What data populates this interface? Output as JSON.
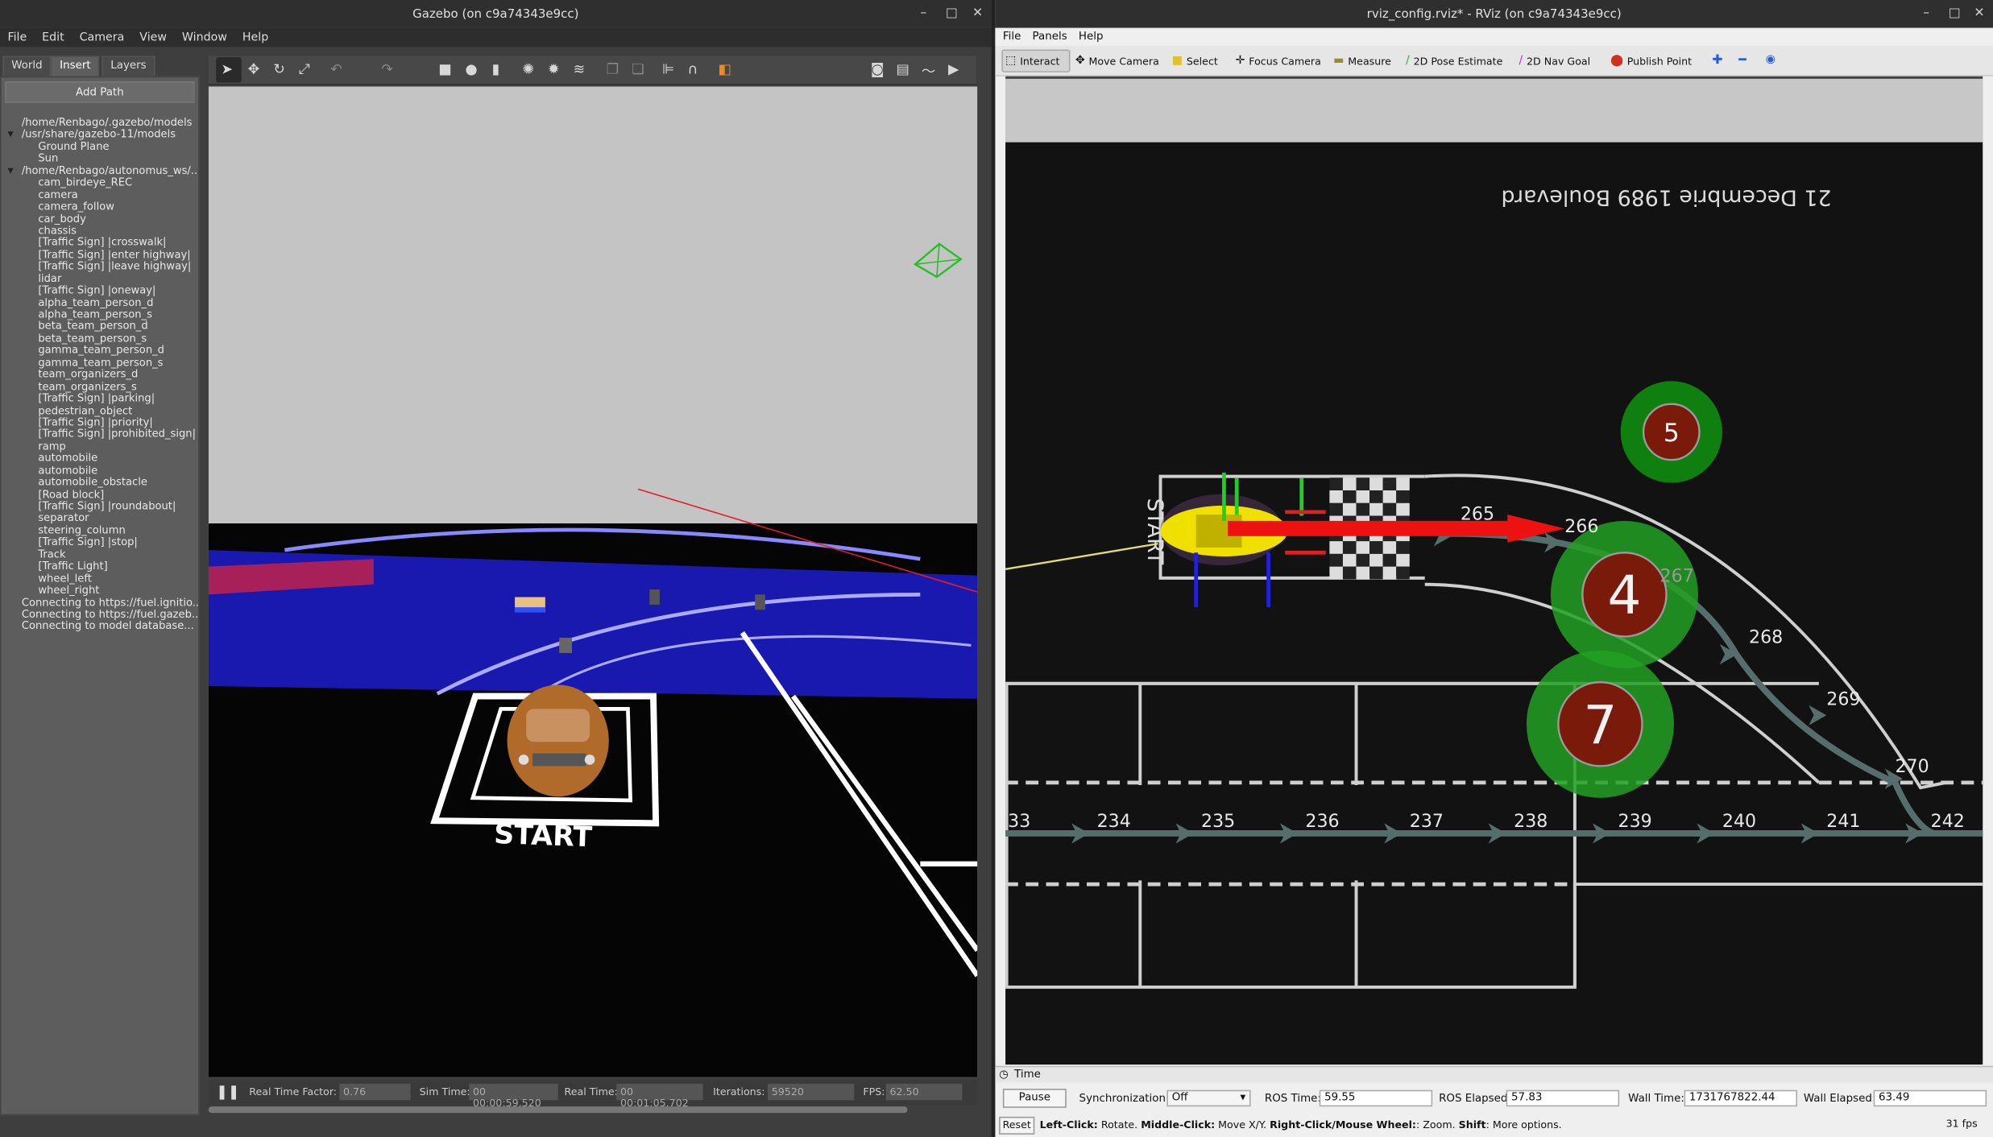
{
  "gazebo": {
    "title": "Gazebo (on c9a74343e9cc)",
    "menu": [
      "File",
      "Edit",
      "Camera",
      "View",
      "Window",
      "Help"
    ],
    "tabs": [
      "World",
      "Insert",
      "Layers"
    ],
    "add_path": "Add Path",
    "tree": [
      "/home/Renbago/.gazebo/models",
      "/usr/share/gazebo-11/models",
      "Ground Plane",
      "Sun",
      "/home/Renbago/autonomus_ws/...",
      "cam_birdeye_REC",
      "camera",
      "camera_follow",
      "car_body",
      "chassis",
      "[Traffic Sign] |crosswalk|",
      "[Traffic Sign] |enter highway|",
      "[Traffic Sign] |leave highway|",
      "lidar",
      "[Traffic Sign] |oneway|",
      "alpha_team_person_d",
      "alpha_team_person_s",
      "beta_team_person_d",
      "beta_team_person_s",
      "gamma_team_person_d",
      "gamma_team_person_s",
      "team_organizers_d",
      "team_organizers_s",
      "[Traffic Sign] |parking|",
      "pedestrian_object",
      "[Traffic Sign] |priority|",
      "[Traffic Sign] |prohibited_sign|",
      "ramp",
      "automobile",
      "automobile",
      "automobile_obstacle",
      "[Road block]",
      "[Traffic Sign] |roundabout|",
      "separator",
      "steering_column",
      "[Traffic Sign] |stop|",
      "Track",
      "[Traffic Light]",
      "wheel_left",
      "wheel_right",
      "Connecting to https://fuel.ignitio...",
      "Connecting to https://fuel.gazeb...",
      "Connecting to model database..."
    ],
    "status": {
      "rtf_label": "Real Time Factor:",
      "rtf": "0.76",
      "sim_label": "Sim Time:",
      "sim": "00 00:00:59.520",
      "real_label": "Real Time:",
      "real": "00 00:01:05.702",
      "iter_label": "Iterations:",
      "iter": "59520",
      "fps_label": "FPS:",
      "fps": "62.50"
    },
    "scene_text": "START"
  },
  "rviz": {
    "title": "rviz_config.rviz* - RViz (on c9a74343e9cc)",
    "menu": [
      "File",
      "Panels",
      "Help"
    ],
    "tools": [
      "Interact",
      "Move Camera",
      "Select",
      "Focus Camera",
      "Measure",
      "2D Pose Estimate",
      "2D Nav Goal",
      "Publish Point"
    ],
    "map_text": "21 Decembrie 1989 Boulevard",
    "start_text": "START",
    "circles": [
      "5",
      "4",
      "7"
    ],
    "nodes_top": [
      "265",
      "266",
      "267",
      "268",
      "269",
      "270"
    ],
    "nodes_bottom": [
      "33",
      "234",
      "235",
      "236",
      "237",
      "238",
      "239",
      "240",
      "241",
      "242"
    ],
    "time_panel": "Time",
    "pause": "Pause",
    "sync_label": "Synchronization:",
    "sync": "Off",
    "ros_time_label": "ROS Time:",
    "ros_time": "59.55",
    "ros_elapsed_label": "ROS Elapsed:",
    "ros_elapsed": "57.83",
    "wall_time_label": "Wall Time:",
    "wall_time": "1731767822.44",
    "wall_elapsed_label": "Wall Elapsed:",
    "wall_elapsed": "63.49",
    "reset": "Reset",
    "help": {
      "b1": "Left-Click:",
      "t1": " Rotate. ",
      "b2": "Middle-Click:",
      "t2": " Move X/Y. ",
      "b3": "Right-Click/Mouse Wheel:",
      "t3": ": Zoom. ",
      "b4": "Shift",
      "t4": ": More options."
    },
    "fps": "31 fps"
  },
  "colors": {
    "green": "#1fa31f",
    "darkred": "#7a1a0a",
    "nav_arrow": "#566e6b"
  }
}
